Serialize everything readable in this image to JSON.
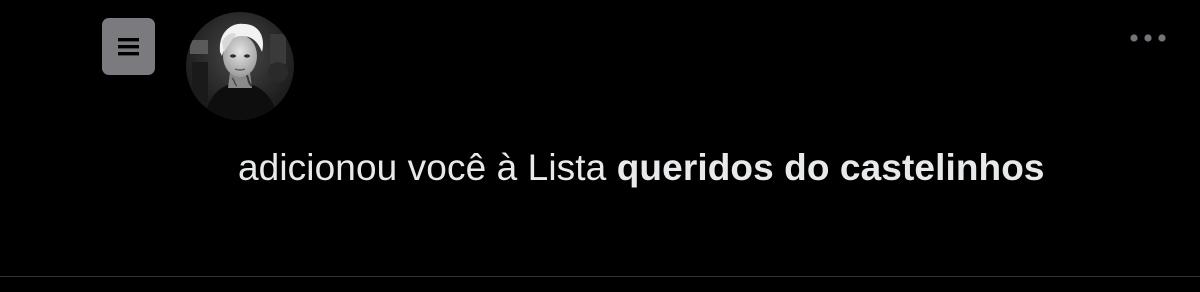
{
  "notification": {
    "type_icon": "list-icon",
    "avatar_icon": "user-avatar",
    "more_icon": "more-options-icon",
    "actor_name": "",
    "action_text": "adicionou você à Lista",
    "list_name": "queridos do castelinhos"
  },
  "colors": {
    "background": "#000000",
    "text": "#e7e9ea",
    "icon_badge": "#7b7b7f",
    "more_icon": "#71767b",
    "divider": "#2f3336"
  }
}
